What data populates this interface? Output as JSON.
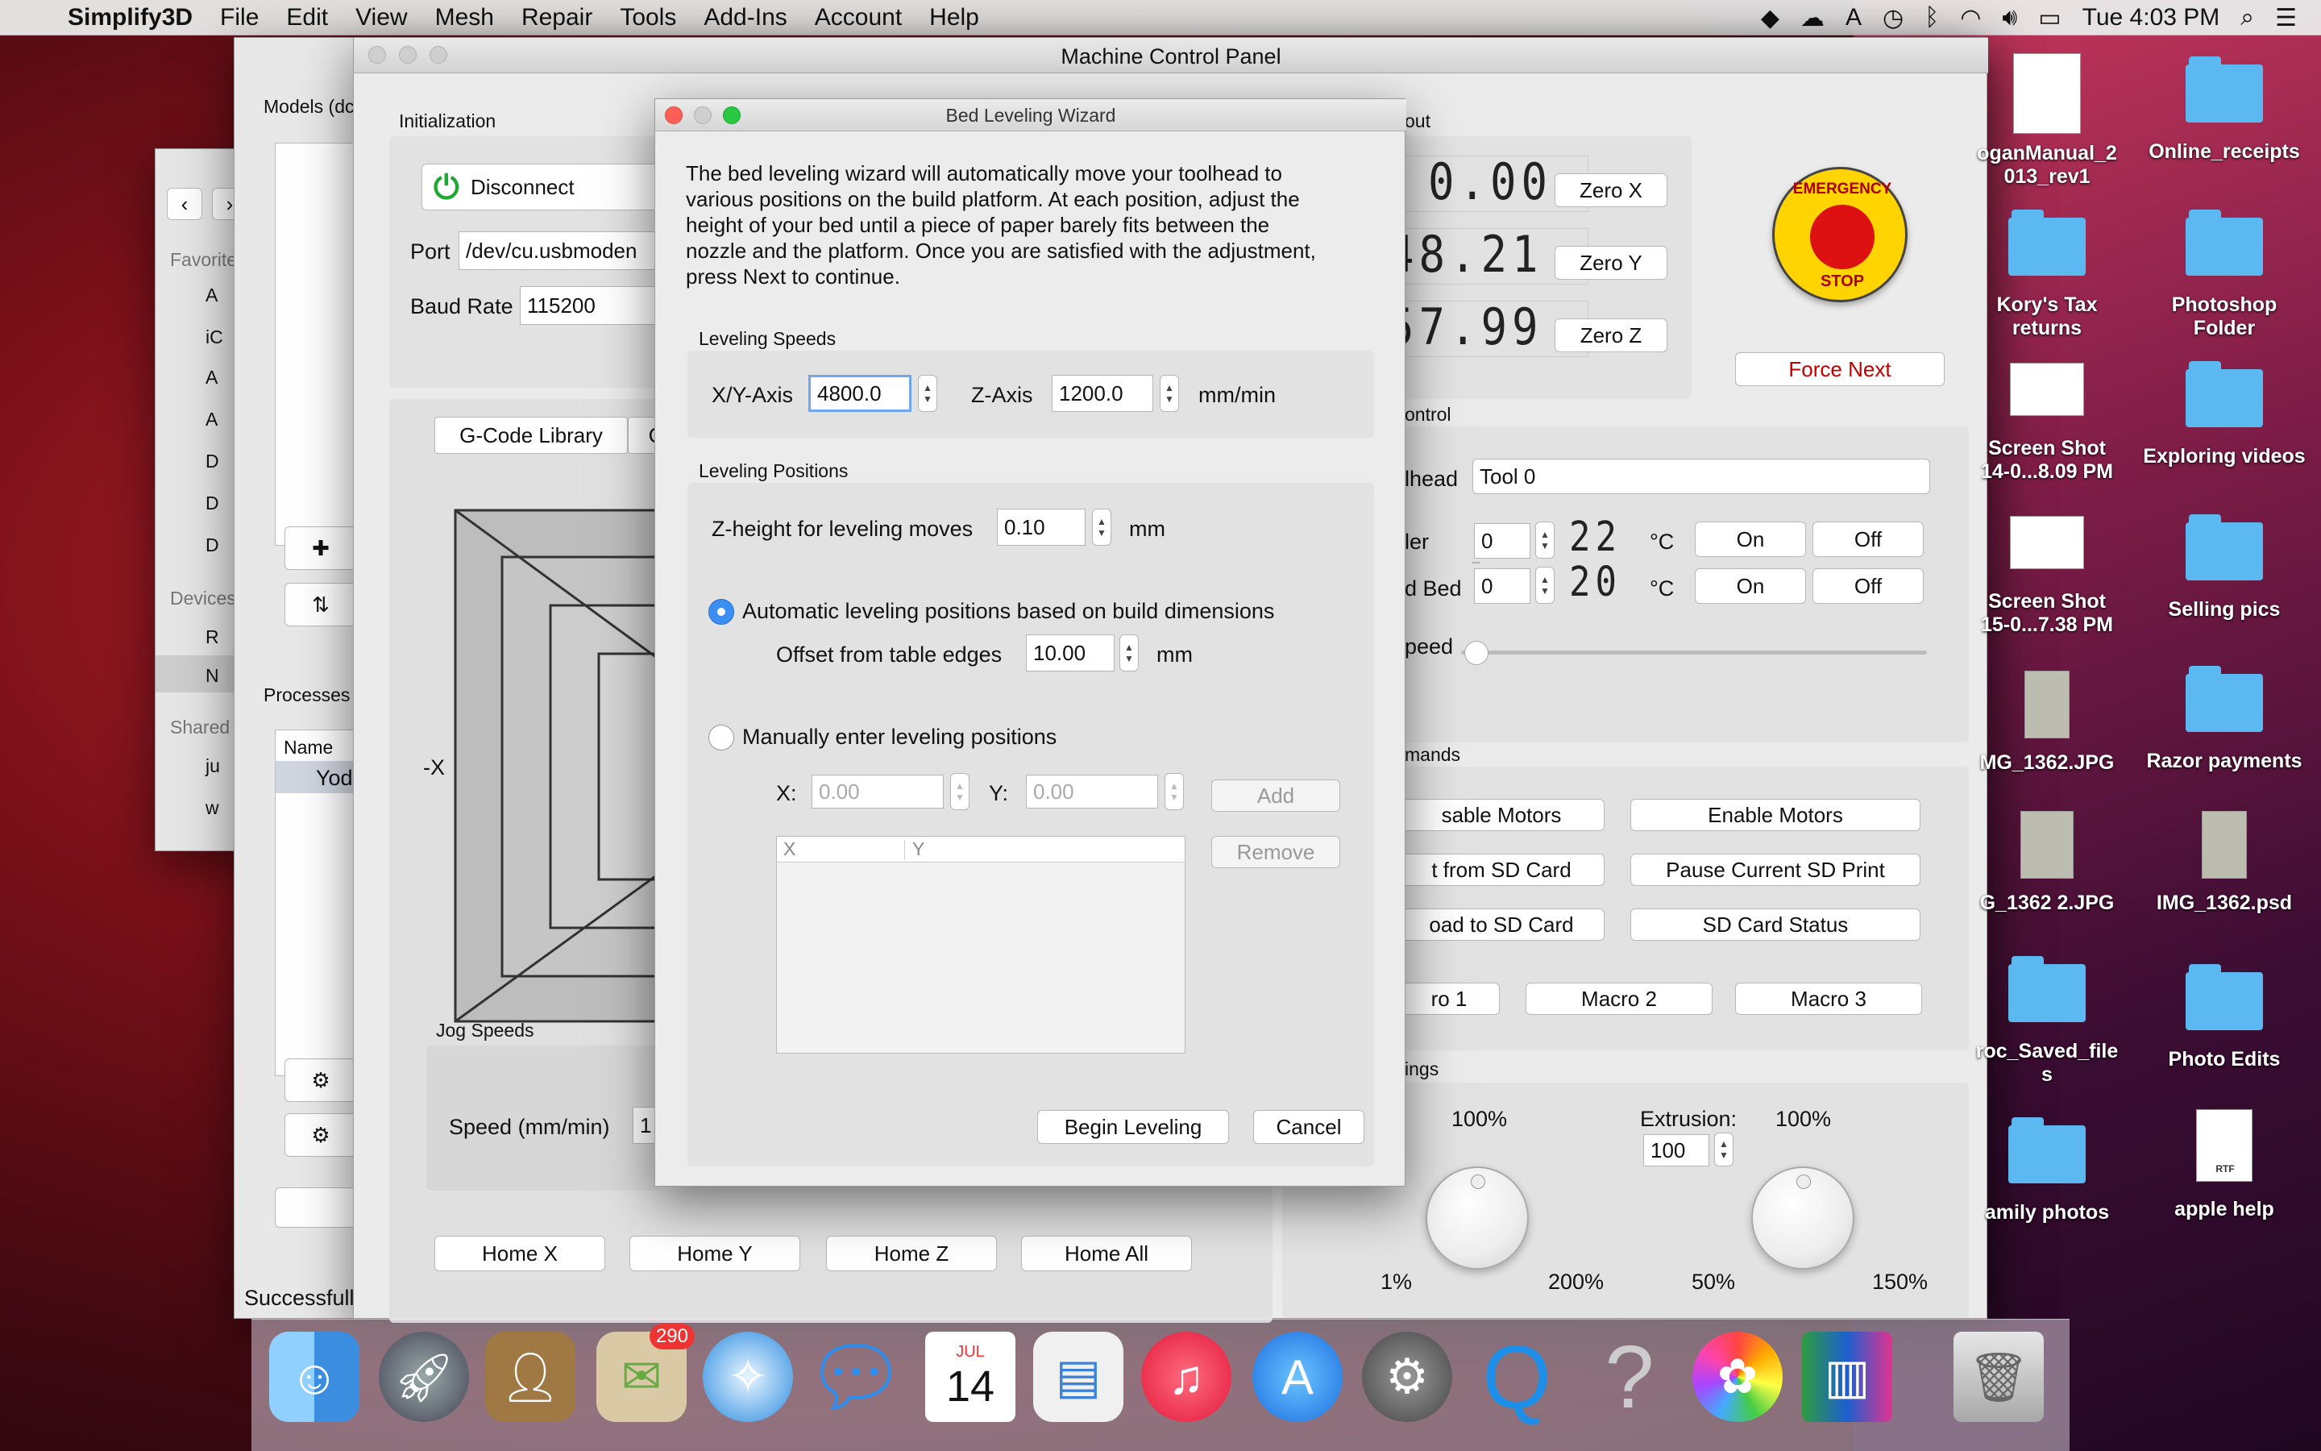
{
  "menubar": {
    "app": "Simplify3D",
    "items": [
      "File",
      "Edit",
      "View",
      "Mesh",
      "Repair",
      "Tools",
      "Add-Ins",
      "Account",
      "Help"
    ],
    "clock": "Tue 4:03 PM"
  },
  "finder": {
    "sidebar": {
      "favorites": "Favorite",
      "devices": "Devices",
      "shared": "Shared",
      "items": [
        "A",
        "iC",
        "A",
        "A",
        "D",
        "D",
        "D",
        "R",
        "N",
        "ju",
        "w"
      ]
    }
  },
  "s3d": {
    "models": "Models (dc",
    "processes": "Processes",
    "name_col": "Name",
    "process_row": "Yod",
    "status": "Successfull"
  },
  "mcp": {
    "title": "Machine Control Panel",
    "init": "Initialization",
    "disconnect": "Disconnect",
    "port_label": "Port",
    "port_value": "/dev/cu.usbmoden",
    "baud_label": "Baud Rate",
    "baud_value": "115200",
    "tab_gcode": "G-Code Library",
    "tab_c": "C",
    "minus_x": "-X",
    "jog_speeds": "Jog Speeds",
    "speed_label": "Speed (mm/min)",
    "speed_value": "1",
    "home_x": "Home X",
    "home_y": "Home Y",
    "home_z": "Home Z",
    "home_all": "Home All",
    "readout": "out",
    "x_val": "0.00",
    "y_val": "48.21",
    "z_val": "57.99",
    "zero_x": "Zero X",
    "zero_y": "Zero Y",
    "zero_z": "Zero Z",
    "force_next": "Force Next",
    "emergency": "EMERGENCY",
    "stop": "STOP",
    "control": "ontrol",
    "toolhead_label": "lhead",
    "toolhead_value": "Tool 0",
    "extruder_label": "ler",
    "extruder_set": "0",
    "extruder_temp": "22",
    "bed_label": "d Bed",
    "bed_set": "0",
    "bed_temp": "20",
    "deg_c": "°C",
    "on": "On",
    "off": "Off",
    "speed": "peed",
    "commands": "mands",
    "disable_motors": "sable Motors",
    "enable_motors": "Enable Motors",
    "print_sd": "t from SD Card",
    "pause_sd": "Pause Current SD Print",
    "upload_sd": "oad to SD Card",
    "sd_status": "SD Card Status",
    "macro1": "ro 1",
    "macro2": "Macro 2",
    "macro3": "Macro 3",
    "settings": "ings",
    "speed_pct": "100%",
    "extrusion_label": "Extrusion:",
    "extrusion_pct": "100%",
    "extrusion_value": "100",
    "knob1_min": "1%",
    "knob1_max": "200%",
    "knob2_min": "50%",
    "knob2_max": "150%",
    "colon": ":"
  },
  "wizard": {
    "title": "Bed Leveling Wizard",
    "intro": [
      "The bed leveling wizard will automatically move your toolhead to",
      "various positions on the build platform.  At each position, adjust the",
      "height of your bed until a piece of paper barely fits between the",
      "nozzle and the platform.  Once you are satisfied with the adjustment,",
      "press Next to continue."
    ],
    "speeds_title": "Leveling Speeds",
    "xy_label": "X/Y-Axis",
    "xy_value": "4800.0",
    "z_label": "Z-Axis",
    "z_value": "1200.0",
    "unit_speed": "mm/min",
    "positions_title": "Leveling Positions",
    "zheight_label": "Z-height for leveling moves",
    "zheight_value": "0.10",
    "mm": "mm",
    "auto_label": "Automatic leveling positions based on build dimensions",
    "offset_label": "Offset from table edges",
    "offset_value": "10.00",
    "manual_label": "Manually enter leveling positions",
    "x_label": "X:",
    "x_placeholder": "0.00",
    "y_label": "Y:",
    "y_placeholder": "0.00",
    "add": "Add",
    "remove": "Remove",
    "col_x": "X",
    "col_y": "Y",
    "begin": "Begin Leveling",
    "cancel": "Cancel"
  },
  "desktop": [
    {
      "label": "oganManual_2\n013_rev1"
    },
    {
      "label": "Online_receipts"
    },
    {
      "label": "Kory's Tax\nreturns"
    },
    {
      "label": "Photoshop\nFolder"
    },
    {
      "label": "Screen Shot\n14-0...8.09 PM"
    },
    {
      "label": "Exploring videos"
    },
    {
      "label": "Screen Shot\n15-0...7.38 PM"
    },
    {
      "label": "Selling pics"
    },
    {
      "label": "MG_1362.JPG"
    },
    {
      "label": "Razor payments"
    },
    {
      "label": "G_1362 2.JPG"
    },
    {
      "label": "IMG_1362.psd"
    },
    {
      "label": "roc_Saved_file\ns"
    },
    {
      "label": "Photo Edits"
    },
    {
      "label": "amily photos"
    },
    {
      "label": "apple help"
    }
  ],
  "dock": {
    "badge": "290",
    "cal_month": "JUL",
    "cal_day": "14",
    "rtf": "RTF",
    "help": "?"
  },
  "colors": {
    "accent": "#3b8ff2",
    "force_next": "#c00000",
    "emergency": "#ffd400"
  }
}
